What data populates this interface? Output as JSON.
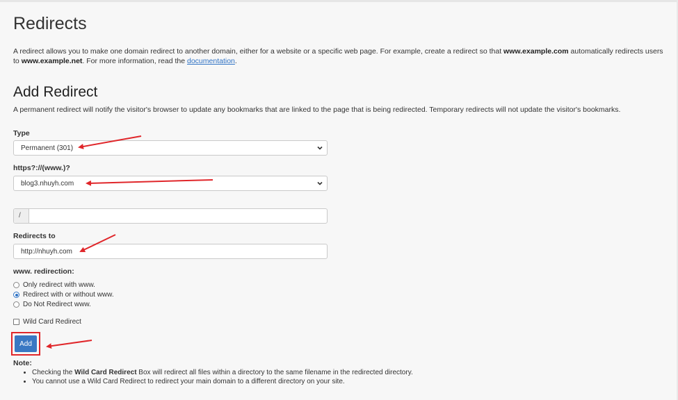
{
  "page": {
    "title": "Redirects",
    "intro": {
      "line1_before": "A redirect allows you to make one domain redirect to another domain, either for a website or a specific web page. For example, create a redirect so that ",
      "line1_bold": "www.example.com",
      "line1_after": " automatically redirects users",
      "line2_before": "to ",
      "line2_bold": "www.example.net",
      "line2_mid": ". For more information, read the ",
      "doc_link": "documentation",
      "line2_end": "."
    }
  },
  "add_redirect": {
    "heading": "Add Redirect",
    "description": "A permanent redirect will notify the visitor's browser to update any bookmarks that are linked to the page that is being redirected. Temporary redirects will not update the visitor's bookmarks.",
    "type": {
      "label": "Type",
      "selected": "Permanent (301)"
    },
    "domain": {
      "label": "https?://(www.)?",
      "selected": "blog3.nhuyh.com"
    },
    "path": {
      "prefix": "/",
      "value": ""
    },
    "redirects_to": {
      "label": "Redirects to",
      "value": "http://nhuyh.com"
    },
    "www_redirection": {
      "label": "www. redirection:",
      "options": [
        "Only redirect with www.",
        "Redirect with or without www.",
        "Do Not Redirect www."
      ],
      "selected_index": 1
    },
    "wildcard": {
      "label": "Wild Card Redirect",
      "checked": false
    },
    "add_button": "Add"
  },
  "note": {
    "title": "Note:",
    "item1_before": "Checking the ",
    "item1_bold": "Wild Card Redirect",
    "item1_after": " Box will redirect all files within a directory to the same filename in the redirected directory.",
    "item2": "You cannot use a Wild Card Redirect to redirect your main domain to a different directory on your site."
  },
  "colors": {
    "accent": "#3a78c3",
    "annotation": "#e0262a",
    "link": "#2f72c4"
  }
}
